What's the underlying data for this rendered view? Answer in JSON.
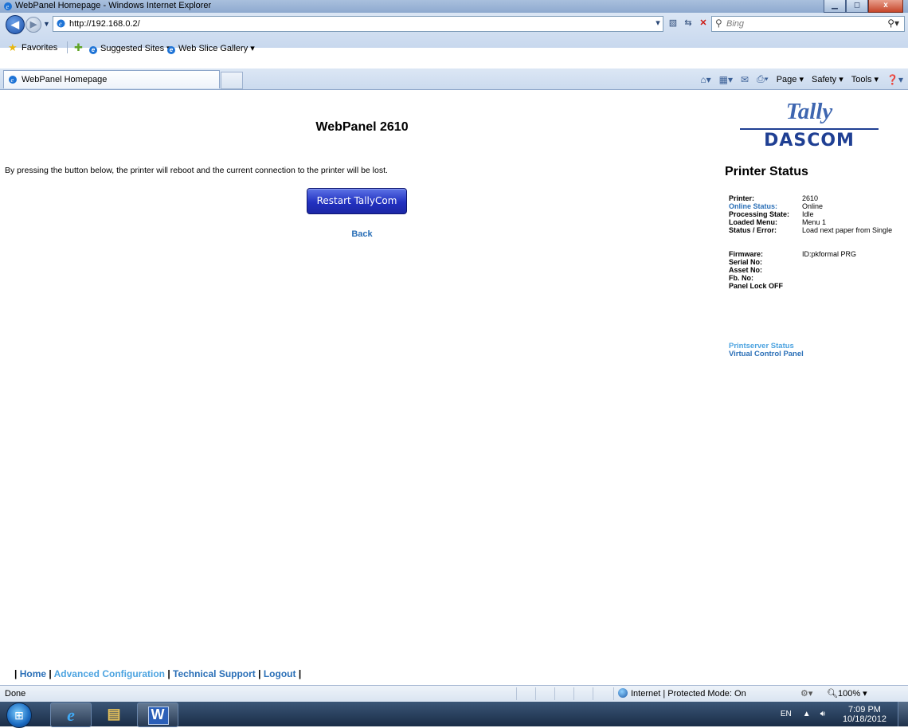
{
  "window": {
    "title": "WebPanel Homepage - Windows Internet Explorer",
    "minimize": "▁",
    "maximize": "◻",
    "close": "x"
  },
  "address_bar": {
    "url": "http://192.168.0.2/",
    "search_placeholder": "Bing"
  },
  "favorites_bar": {
    "favorites_label": "Favorites",
    "suggested_sites": "Suggested Sites ▾",
    "web_slice_gallery": "Web Slice Gallery ▾"
  },
  "tabs": [
    {
      "label": "WebPanel Homepage"
    }
  ],
  "command_bar": {
    "page": "Page ▾",
    "safety": "Safety ▾",
    "tools": "Tools ▾",
    "help": "❓▾"
  },
  "page": {
    "title": "WebPanel 2610",
    "message": "By pressing the button below, the printer will reboot and the current connection to the printer will be lost.",
    "restart_button": "Restart TallyCom",
    "back_link": "Back",
    "logo_top": "Tally",
    "logo_bottom": "DASCOM",
    "status_heading": "Printer Status",
    "status": {
      "printer_label": "Printer:",
      "printer_value": "2610",
      "online_label": "Online Status:",
      "online_value": "Online",
      "processing_label": "Processing State:",
      "processing_value": "Idle",
      "menu_label": "Loaded Menu:",
      "menu_value": "Menu 1",
      "error_label": "Status / Error:",
      "error_value": "Load next paper from Single",
      "firmware_label": "Firmware:",
      "firmware_value": "ID:pkformal PRG",
      "serial_label": "Serial No:",
      "asset_label": "Asset No:",
      "fb_label": "Fb. No:",
      "panel_lock": "Panel Lock OFF"
    },
    "printserver_link": "Printserver Status",
    "vcp_link": "Virtual Control Panel",
    "footer": {
      "home": "Home",
      "advanced": "Advanced Configuration",
      "support": "Technical Support",
      "logout": "Logout"
    }
  },
  "status_bar": {
    "done": "Done",
    "zone": "Internet | Protected Mode: On",
    "zoom": "100% ▾"
  },
  "taskbar": {
    "lang": "EN",
    "time": "7:09 PM",
    "date": "10/18/2012"
  }
}
